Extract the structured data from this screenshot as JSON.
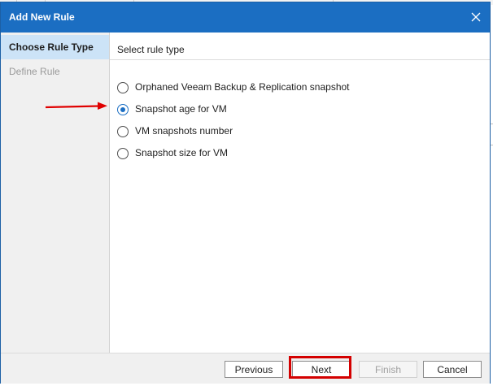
{
  "dialog": {
    "title": "Add New Rule",
    "close_icon": "close-icon"
  },
  "nav": {
    "items": [
      {
        "label": "Choose Rule Type",
        "active": true
      },
      {
        "label": "Define Rule",
        "active": false
      }
    ]
  },
  "content": {
    "section_label": "Select rule type",
    "options": [
      {
        "label": "Orphaned Veeam Backup & Replication snapshot",
        "checked": false
      },
      {
        "label": "Snapshot age for VM",
        "checked": true
      },
      {
        "label": "VM snapshots number",
        "checked": false
      },
      {
        "label": "Snapshot size for VM",
        "checked": false
      }
    ]
  },
  "footer": {
    "previous_label": "Previous",
    "next_label": "Next",
    "finish_label": "Finish",
    "cancel_label": "Cancel"
  },
  "annotations": {
    "arrow_color": "#e00000",
    "highlight_color": "#d40000"
  },
  "colors": {
    "titlebar": "#1b6ec2",
    "nav_active": "#cce3f7",
    "radio_accent": "#1c6fc4"
  }
}
